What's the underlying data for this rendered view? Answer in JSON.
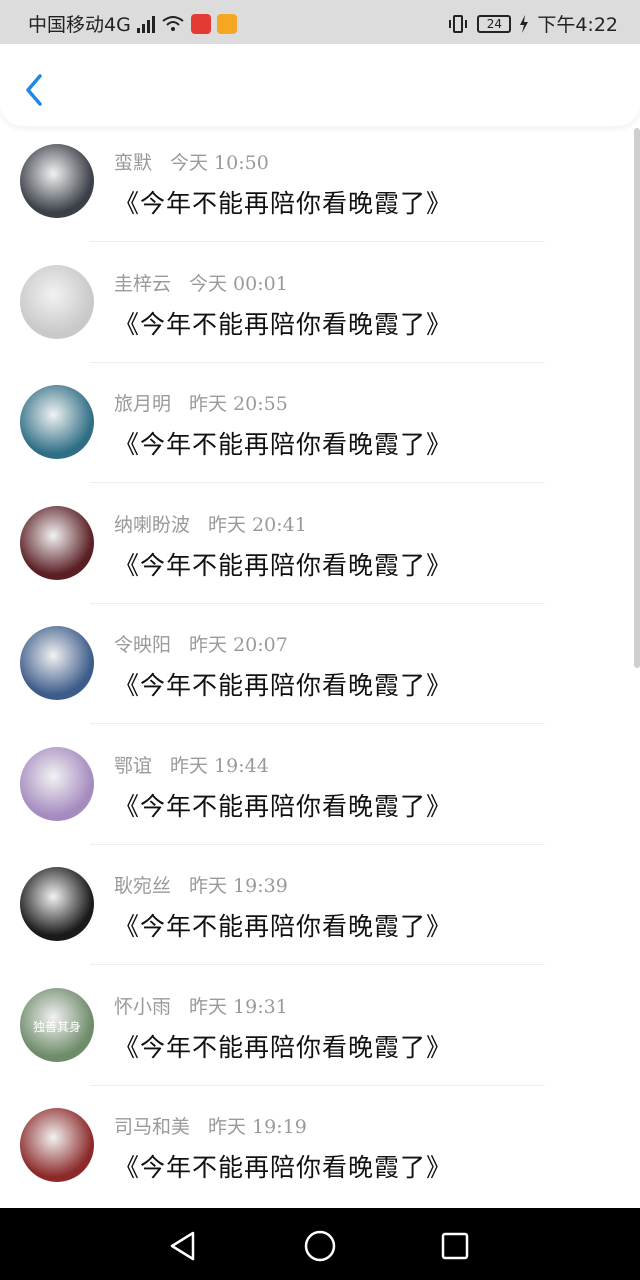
{
  "status_bar": {
    "carrier": "中国移动4G",
    "network_type": "4G",
    "battery": "24",
    "time": "下午4:22"
  },
  "header": {
    "back_icon": "chevron-left-icon",
    "accent_color": "#1e88e5"
  },
  "items": [
    {
      "name": "蛮默",
      "time": "今天 10:50",
      "message": "《今年不能再陪你看晚霞了》",
      "avatar_color": "#3a3f48"
    },
    {
      "name": "圭梓云",
      "time": "今天 00:01",
      "message": "《今年不能再陪你看晚霞了》",
      "avatar_color": "#c9c9c9"
    },
    {
      "name": "旅月明",
      "time": "昨天 20:55",
      "message": "《今年不能再陪你看晚霞了》",
      "avatar_color": "#2f6f86"
    },
    {
      "name": "纳喇盼波",
      "time": "昨天 20:41",
      "message": "《今年不能再陪你看晚霞了》",
      "avatar_color": "#5a1f24"
    },
    {
      "name": "令映阳",
      "time": "昨天 20:07",
      "message": "《今年不能再陪你看晚霞了》",
      "avatar_color": "#3d5c8a"
    },
    {
      "name": "鄂谊",
      "time": "昨天 19:44",
      "message": "《今年不能再陪你看晚霞了》",
      "avatar_color": "#a58bbf"
    },
    {
      "name": "耿宛丝",
      "time": "昨天 19:39",
      "message": "《今年不能再陪你看晚霞了》",
      "avatar_color": "#1a1a1a"
    },
    {
      "name": "怀小雨",
      "time": "昨天 19:31",
      "message": "《今年不能再陪你看晚霞了》",
      "avatar_color": "#6e8b6a",
      "avatar_caption": "独善其身"
    },
    {
      "name": "司马和美",
      "time": "昨天 19:19",
      "message": "《今年不能再陪你看晚霞了》",
      "avatar_color": "#8c2a2a"
    }
  ],
  "nav_bar": {
    "back_icon": "triangle-back-icon",
    "home_icon": "circle-home-icon",
    "recents_icon": "square-recents-icon"
  }
}
